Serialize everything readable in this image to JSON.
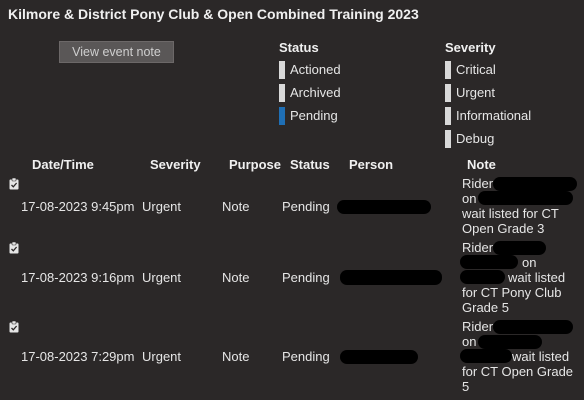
{
  "title": "Kilmore & District Pony Club & Open Combined Training 2023",
  "view_button": "View event note",
  "status_legend": {
    "heading": "Status",
    "items": [
      {
        "label": "Actioned",
        "color": "#d9d9d9"
      },
      {
        "label": "Archived",
        "color": "#d9d9d9"
      },
      {
        "label": "Pending",
        "color": "#1f6fb5"
      }
    ]
  },
  "severity_legend": {
    "heading": "Severity",
    "items": [
      {
        "label": "Critical",
        "color": "#d9d9d9"
      },
      {
        "label": "Urgent",
        "color": "#d9d9d9"
      },
      {
        "label": "Informational",
        "color": "#d9d9d9"
      },
      {
        "label": "Debug",
        "color": "#d9d9d9"
      }
    ]
  },
  "table": {
    "headers": [
      "Date/Time",
      "Severity",
      "Purpose",
      "Status",
      "Person",
      "Note"
    ],
    "rows": [
      {
        "datetime": "17-08-2023 9:45pm",
        "severity": "Urgent",
        "purpose": "Note",
        "status": "Pending",
        "note": {
          "l1": "Rider",
          "l2": "on",
          "l3": "wait listed for CT",
          "l4": "Open Grade 3"
        }
      },
      {
        "datetime": "17-08-2023 9:16pm",
        "severity": "Urgent",
        "purpose": "Note",
        "status": "Pending",
        "note": {
          "l1": "Rider",
          "l2": "on",
          "l3": "wait listed",
          "l4": "for CT Pony Club",
          "l5": "Grade 5"
        }
      },
      {
        "datetime": "17-08-2023 7:29pm",
        "severity": "Urgent",
        "purpose": "Note",
        "status": "Pending",
        "note": {
          "l1": "Rider",
          "l2": "on",
          "l3": "wait listed",
          "l4": "for CT Open Grade",
          "l5": "5"
        }
      }
    ]
  }
}
